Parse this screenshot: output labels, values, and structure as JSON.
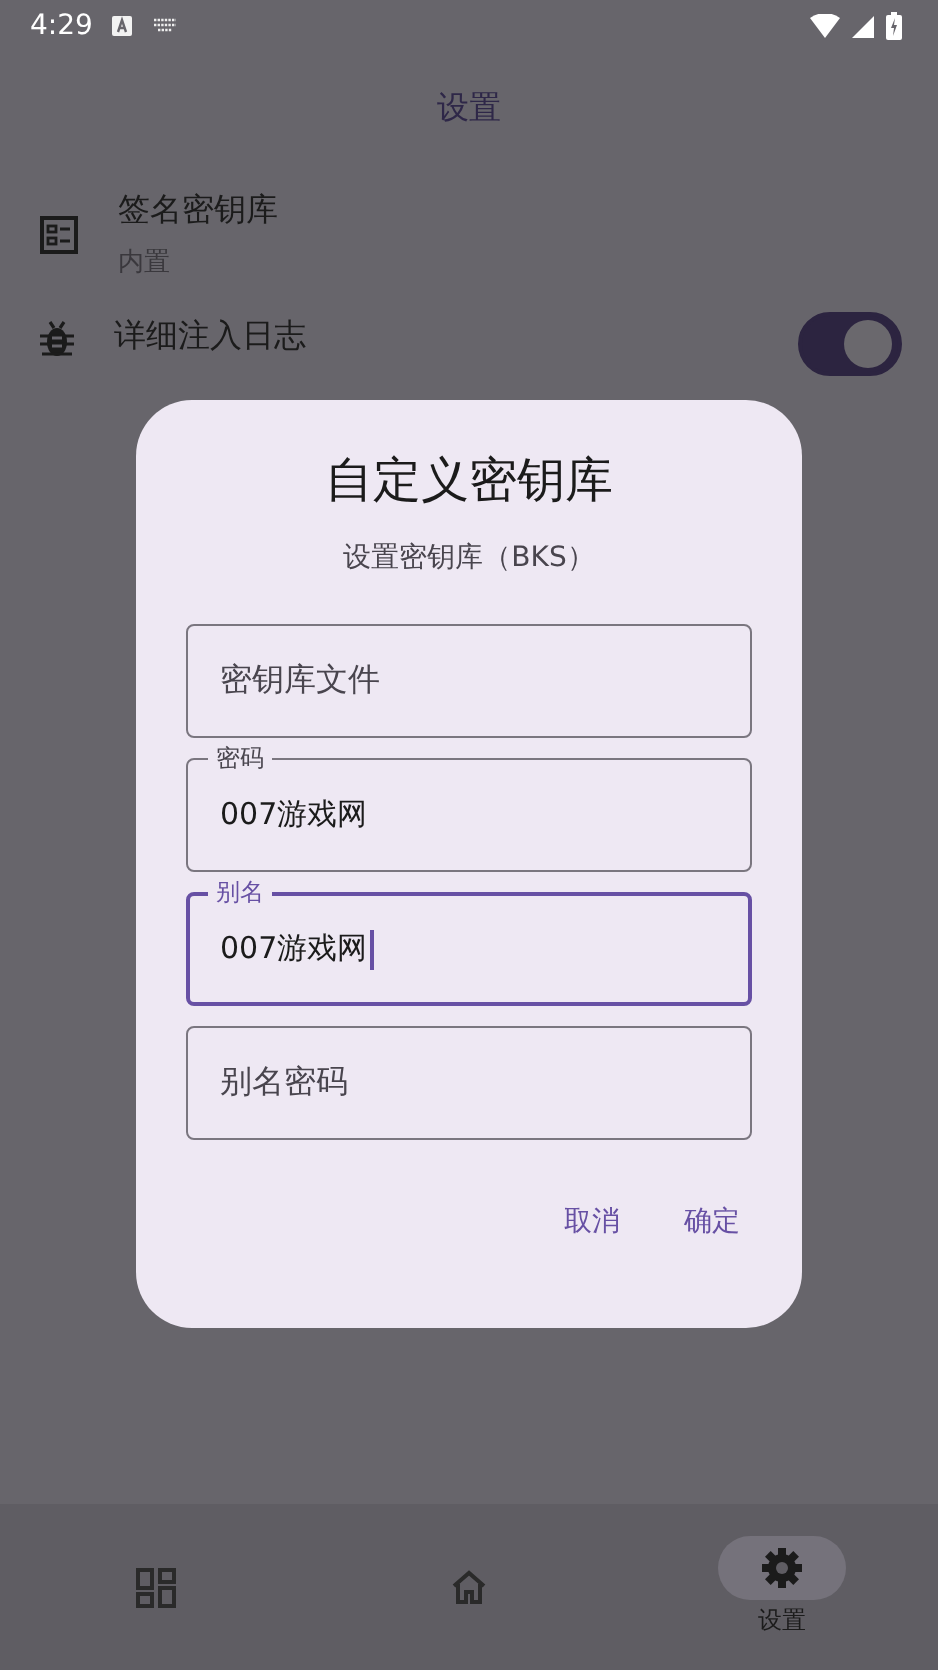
{
  "status_bar": {
    "time": "4:29"
  },
  "app_bar": {
    "title": "设置"
  },
  "settings": [
    {
      "kind": "keystore",
      "title": "签名密钥库",
      "subtitle": "内置"
    },
    {
      "kind": "toggle",
      "title": "详细注入日志",
      "on": true
    }
  ],
  "dialog": {
    "title": "自定义密钥库",
    "subtitle": "设置密钥库（BKS）",
    "fields": [
      {
        "placeholder": "密钥库文件",
        "focused": false
      },
      {
        "label": "密码",
        "value": "007游戏网",
        "focused": false
      },
      {
        "label": "别名",
        "value": "007游戏网",
        "focused": true
      },
      {
        "placeholder": "别名密码",
        "focused": false
      }
    ],
    "buttons": [
      "取消",
      "确定"
    ]
  },
  "bottom_nav": [
    {
      "selected": false
    },
    {
      "selected": false
    },
    {
      "label": "设置",
      "selected": true
    }
  ]
}
